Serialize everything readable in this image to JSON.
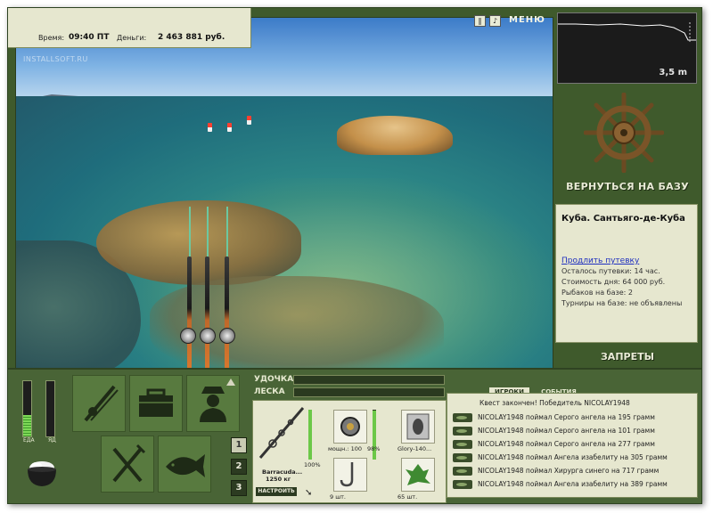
{
  "info": {
    "time_label": "Время:",
    "time_value": "09:40 ПТ",
    "money_label": "Деньги:",
    "money_value": "2 463 881 руб."
  },
  "watermark": "INSTALLSOFT.RU",
  "toolbar": {
    "pause_icon": "pause-icon",
    "sound_icon": "sound-icon",
    "menu_label": "МЕНЮ"
  },
  "sonar": {
    "depth": "3,5 m"
  },
  "right_panel": {
    "back_button": "ВЕРНУТЬСЯ НА БАЗУ",
    "location": "Куба. Сантьяго-де-Куба",
    "extend_link": "Продлить путевку",
    "lines": [
      "Осталось путевки: 14 час.",
      "Стоимость дня: 64 000 руб.",
      "Рыбаков на базе: 2",
      "Турниры на базе: не объявлены"
    ],
    "bans_button": "ЗАПРЕТЫ"
  },
  "vitals": {
    "food_label": "ЕДА",
    "poison_label": "ЯД",
    "food_level": 0.38,
    "poison_level": 0.0
  },
  "tiles": {
    "rods": "rod-icon",
    "box": "tackle-box-icon",
    "fisher": "fisherman-icon",
    "food": "fork-knife-icon",
    "fish": "fish-icon"
  },
  "pages": [
    "1",
    "2",
    "3"
  ],
  "gear": {
    "rod_label": "УДОЧКА",
    "line_label": "ЛЕСКА",
    "rod_name": "Barracuda...",
    "rod_weight": "1250 кг",
    "rod_percent": "100%",
    "reel_caption": "мощн.: 100",
    "reel_percent": "98%",
    "bait_name": "Glory-140...",
    "hook_count": "9 шт.",
    "groundbait_count": "65 шт.",
    "setup_button": "НАСТРОИТЬ"
  },
  "events": {
    "tabs": [
      "ИГРОКИ",
      "СОБЫТИЯ"
    ],
    "header": "Квест закончен! Победитель NICOLAY1948",
    "rows": [
      "NICOLAY1948 поймал Серого ангела на 195 грамм",
      "NICOLAY1948 поймал Серого ангела на 101 грамм",
      "NICOLAY1948 поймал Серого ангела на 277 грамм",
      "NICOLAY1948 поймал Ангела изабелиту на 305 грамм",
      "NICOLAY1948 поймал Хирурга синего на 717 грамм",
      "NICOLAY1948 поймал Ангела изабелиту на 389 грамм"
    ]
  },
  "colors": {
    "panel_green": "#496436",
    "cream": "#e6e7cf",
    "dark_green": "#2c3b21"
  }
}
